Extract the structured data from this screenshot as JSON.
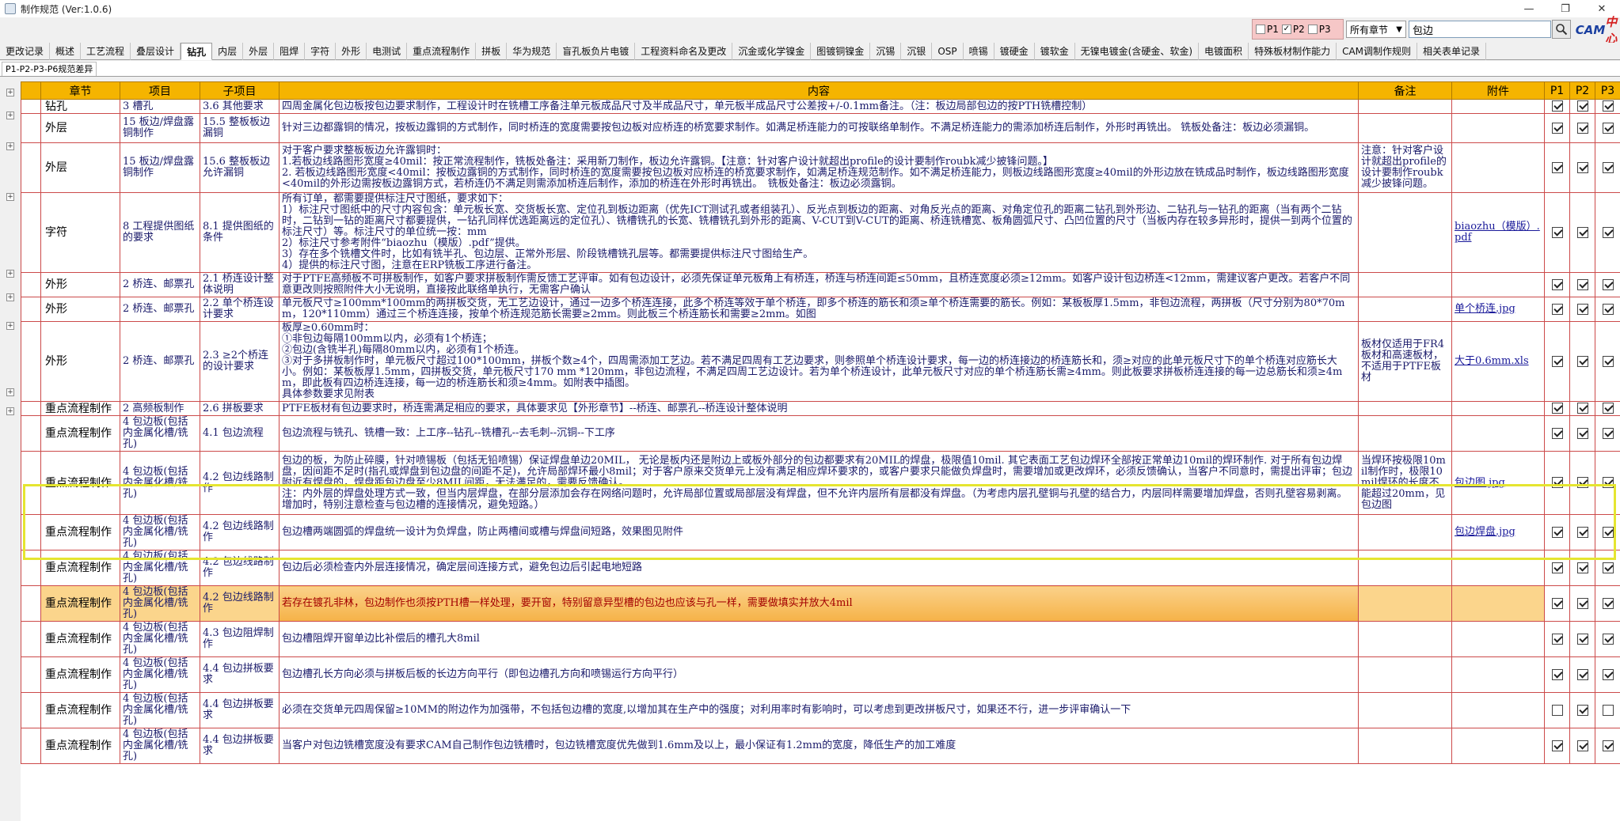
{
  "window": {
    "title": "制作规范 (Ver:1.0.6)",
    "min": "—",
    "restore": "❐",
    "close": "✕"
  },
  "toolbar": {
    "filters": [
      {
        "label": "P1",
        "checked": false
      },
      {
        "label": "P2",
        "checked": true
      },
      {
        "label": "P3",
        "checked": false
      }
    ],
    "chapter_select": "所有章节",
    "search_value": "包边",
    "logo_a": "CAM",
    "logo_b": "中心"
  },
  "tabs": [
    "更改记录",
    "概述",
    "工艺流程",
    "叠层设计",
    "钻孔",
    "内层",
    "外层",
    "阻焊",
    "字符",
    "外形",
    "电测试",
    "重点流程制作",
    "拼板",
    "华为规范",
    "盲孔板负片电镀",
    "工程资料命名及更改",
    "沉金或化学镍金",
    "图镀铜镍金",
    "沉锡",
    "沉银",
    "OSP",
    "喷锡",
    "镀硬金",
    "镀软金",
    "无镍电镀金(含硬金、软金)",
    "电镀面积",
    "特殊板材制作能力",
    "CAM调制作规则",
    "相关表单记录"
  ],
  "active_tab": "钻孔",
  "subtab": "P1-P2-P3-P6规范差异",
  "columns": {
    "chapter": "章节",
    "item": "项目",
    "subitem": "子项目",
    "content": "内容",
    "remark": "备注",
    "attachment": "附件",
    "p1": "P1",
    "p2": "P2",
    "p3": "P3"
  },
  "rows": [
    {
      "chapter": "钻孔",
      "item": "3 槽孔",
      "subitem": "3.6 其他要求",
      "content": "四周金属化包边板按包边要求制作，工程设计时在铣槽工序备注单元板成品尺寸及半成品尺寸，单元板半成品尺寸公差按+/-0.1mm备注。（注：板边局部包边的按PTH铣槽控制）",
      "remark": "",
      "attachment": "",
      "p1": true,
      "p2": true,
      "p3": true
    },
    {
      "chapter": "外层",
      "item": "15 板边/焊盘露铜制作",
      "subitem": "15.5 整板板边漏铜",
      "content": "针对三边都露铜的情况，按板边露铜的方式制作，同时桥连的宽度需要按包边板对应桥连的桥宽要求制作。如满足桥连能力的可按联络单制作。不满足桥连能力的需添加桥连后制作，外形时再铣出。 铣板处备注：板边必须漏铜。",
      "remark": "",
      "attachment": "",
      "p1": true,
      "p2": true,
      "p3": true
    },
    {
      "chapter": "外层",
      "item": "15 板边/焊盘露铜制作",
      "subitem": "15.6 整板板边允许漏铜",
      "content": "对于客户要求整板板边允许露铜时：\n1.若板边线路图形宽度≥40mil：按正常流程制作，铣板处备注：采用新刀制作，板边允许露铜。【注意：针对客户设计就超出profile的设计要制作roubk减少披锋问题。】\n2. 若板边线路图形宽度<40mil：按板边露铜的方式制作，同时桥连的宽度需要按包边板对应桥连的桥宽要求制作，如满足桥连规范制作。如不满足桥连能力，则板边线路图形宽度≥40mil的外形边放在铣成品时制作，板边线路图形宽度<40mil的外形边需按板边露铜方式，若桥连仍不满足则需添加桥连后制作，添加的桥连在外形时再铣出。　铣板处备注：板边必须露铜。",
      "remark": "注意：针对客户设计就超出profile的设计要制作roubk减少披锋问题。",
      "attachment": "",
      "p1": true,
      "p2": true,
      "p3": true
    },
    {
      "chapter": "字符",
      "item": "8 工程提供图纸的要求",
      "subitem": "8.1 提供图纸的条件",
      "content": "所有订单，都需要提供标注尺寸图纸，要求如下：\n1）标注尺寸图纸中的尺寸内容包含：单元板长宽、交货板长宽、定位孔到板边距离（优先ICT测试孔或者组装孔）、反光点到板边的距离、对角反光点的距离、对角定位孔的距离二钻孔到外形边、二钻孔与一钻孔的距离（当有两个二钻时，二钻到一钻的距离尺寸都要提供，一钻孔同样优选距离远的定位孔）、铣槽铣孔的长宽、铣槽铣孔到外形的距离、V-CUT到V-CUT的距离、桥连铣槽宽、板角圆弧尺寸、凸凹位置的尺寸（当板内存在较多异形时，提供一到两个位置的标注尺寸）等。标注尺寸的单位统一按：mm\n2）标注尺寸参考附件“biaozhu（模版）.pdf”提供。\n3）存在多个铣槽文件时，比如有铣半孔、包边层、正常外形层、阶段铣槽铣孔层等。都需要提供标注尺寸图给生产。\n4）提供的标注尺寸图，注意在ERP铣板工序进行备注。",
      "remark": "",
      "attachment": "biaozhu（模版）.pdf",
      "p1": true,
      "p2": true,
      "p3": true
    },
    {
      "chapter": "外形",
      "item": "2 桥连、邮票孔",
      "subitem": "2.1 桥连设计整体说明",
      "content": "对于PTFE高频板不可拼板制作，如客户要求拼板制作需反馈工艺评审。如有包边设计，必须先保证单元板角上有桥连，桥连与桥连间距≤50mm，且桥连宽度必须≥12mm。如客户设计包边桥连<12mm，需建议客户更改。若客户不同意更改则按照附件大小无说明，直接按此联络单执行，无需客户确认",
      "remark": "",
      "attachment": "",
      "p1": true,
      "p2": true,
      "p3": true
    },
    {
      "chapter": "外形",
      "item": "2 桥连、邮票孔",
      "subitem": "2.2 单个桥连设计要求",
      "content": "单元板尺寸≥100mm*100mm的两拼板交货，无工艺边设计，通过一边多个桥连连接，此多个桥连等效于单个桥连，即多个桥连的筋长和须≥单个桥连需要的筋长。例如：某板板厚1.5mm，非包边流程，两拼板（尺寸分别为80*70mm，120*110mm）通过三个桥连连接，按单个桥连规范筋长需要≥2mm。则此板三个桥连筋长和需要≥2mm。如图",
      "remark": "",
      "attachment": "单个桥连.jpg",
      "p1": true,
      "p2": true,
      "p3": true
    },
    {
      "chapter": "外形",
      "item": "2 桥连、邮票孔",
      "subitem": "2.3 ≥2个桥连的设计要求",
      "content": "板厚≥0.60mm时：\n①非包边每隔100mm以内，必须有1个桥连；\n②包边(含铣半孔)每隔80mm以内，必须有1个桥连。\n③对于多拼板制作时，单元板尺寸超过100*100mm，拼板个数≥4个，四周需添加工艺边。若不满足四周有工艺边要求，则参照单个桥连设计要求，每一边的桥连接边的桥连筋长和，须≥对应的此单元板尺寸下的单个桥连对应筋长大小。例如：某板板厚1.5mm，四拼板交货，单元板尺寸170 mm *120mm，非包边流程，不满足四周工艺边设计。若为单个桥连设计，此单元板尺寸对应的单个桥连筋长需≥4mm。则此板要求拼板桥连连接的每一边总筋长和须≥4mm，即此板有四边桥连连接，每一边的桥连筋长和须≥4mm。如附表中插图。\n具体参数要求见附表",
      "remark": "板材仅适用于FR4板材和高速板材，不适用于PTFE板材",
      "attachment": "大于0.6mm.xls",
      "p1": true,
      "p2": true,
      "p3": true
    },
    {
      "chapter": "重点流程制作",
      "item": "2 高频板制作",
      "subitem": "2.6 拼板要求",
      "content": "PTFE板材有包边要求时，桥连需满足相应的要求，具体要求见【外形章节】--桥连、邮票孔--桥连设计整体说明",
      "remark": "",
      "attachment": "",
      "p1": true,
      "p2": true,
      "p3": true
    },
    {
      "chapter": "重点流程制作",
      "item": "4 包边板(包括内金属化槽/铣孔)",
      "subitem": "4.1 包边流程",
      "content": "包边流程与铣孔、铣槽一致：上工序--钻孔--铣槽孔--去毛刺--沉铜--下工序",
      "remark": "",
      "attachment": "",
      "p1": true,
      "p2": true,
      "p3": true
    },
    {
      "chapter": "重点流程制作",
      "item": "4 包边板(包括内金属化槽/铣孔)",
      "subitem": "4.2 包边线路制作",
      "content": "包边的板，为防止碎膜，针对喷锡板（包括无铅喷锡）保证焊盘单边20MIL， 无论是板内还是附边上或板外部分的包边都要求有20MIL的焊盘，极限值10mil. 其它表面工艺包边焊环全部按正常单边10mil的焊环制作. 对于所有包边焊盘，因间距不足时(指孔或焊盘到包边盘的间距不足)，允许局部焊环最小8mil；对于客户原来交货单元上没有满足相应焊环要求的，或客户要求只能做负焊盘时，需要增加或更改焊环，必须反馈确认，当客户不同意时，需提出评审；包边附近有焊盘的，焊盘距包边盘至少8MIL间距，无法满足的，需要反馈确认。\n注：内外层的焊盘处理方式一致，但当内层焊盘，在部分层添加会存在网络问题时，允许局部位置或局部层没有焊盘，但不允许内层所有层都没有焊盘。（为考虑内层孔壁铜与孔壁的结合力，内层同样需要增加焊盘，否则孔壁容易剥离。增加时，特别注意检查与包边槽的连接情况，避免短路。）",
      "remark": "当焊环按极限10mil制作时，极限10mil焊环的长度不能超过20mm，见包边图",
      "attachment": "包边图.jpg",
      "p1": true,
      "p2": true,
      "p3": true
    },
    {
      "chapter": "重点流程制作",
      "item": "4 包边板(包括内金属化槽/铣孔)",
      "subitem": "4.2 包边线路制作",
      "content": "包边槽两端圆弧的焊盘统一设计为负焊盘，防止两槽间或槽与焊盘间短路，效果图见附件",
      "remark": "",
      "attachment": "包边焊盘.jpg",
      "p1": true,
      "p2": true,
      "p3": true
    },
    {
      "chapter": "重点流程制作",
      "item": "4 包边板(包括内金属化槽/铣孔)",
      "subitem": "4.2 包边线路制作",
      "content": "包边后必须检查内外层连接情况，确定层间连接方式，避免包边后引起电地短路",
      "remark": "",
      "attachment": "",
      "p1": true,
      "p2": true,
      "p3": true
    },
    {
      "chapter": "重点流程制作",
      "item": "4 包边板(包括内金属化槽/铣孔)",
      "subitem": "4.2 包边线路制作",
      "content": "若存在镀孔非林，包边制作也须按PTH槽一样处理，要开窗，特别留意异型槽的包边也应该与孔一样，需要做填实并放大4mil",
      "remark": "",
      "attachment": "",
      "p1": true,
      "p2": true,
      "p3": true,
      "highlight": true
    },
    {
      "chapter": "重点流程制作",
      "item": "4 包边板(包括内金属化槽/铣孔)",
      "subitem": "4.3 包边阻焊制作",
      "content": "包边槽阻焊开窗单边比补偿后的槽孔大8mil",
      "remark": "",
      "attachment": "",
      "p1": true,
      "p2": true,
      "p3": true
    },
    {
      "chapter": "重点流程制作",
      "item": "4 包边板(包括内金属化槽/铣孔)",
      "subitem": "4.4 包边拼板要求",
      "content": "包边槽孔长方向必须与拼板后板的长边方向平行（即包边槽孔方向和喷锡运行方向平行）",
      "remark": "",
      "attachment": "",
      "p1": true,
      "p2": true,
      "p3": true
    },
    {
      "chapter": "重点流程制作",
      "item": "4 包边板(包括内金属化槽/铣孔)",
      "subitem": "4.4 包边拼板要求",
      "content": "必须在交货单元四周保留≥10MM的附边作为加强带，不包括包边槽的宽度,以增加其在生产中的强度；对利用率时有影响时，可以考虑到更改拼板尺寸，如果还不行，进一步评审确认一下",
      "remark": "",
      "attachment": "",
      "p1": false,
      "p2": true,
      "p3": false
    },
    {
      "chapter": "重点流程制作",
      "item": "4 包边板(包括内金属化槽/铣孔)",
      "subitem": "4.4 包边拼板要求",
      "content": "当客户对包边铣槽宽度没有要求CAM自己制作包边铣槽时，包边铣槽宽度优先做到1.6mm及以上，最小保证有1.2mm的宽度，降低生产的加工难度",
      "remark": "",
      "attachment": "",
      "p1": true,
      "p2": true,
      "p3": true
    }
  ]
}
